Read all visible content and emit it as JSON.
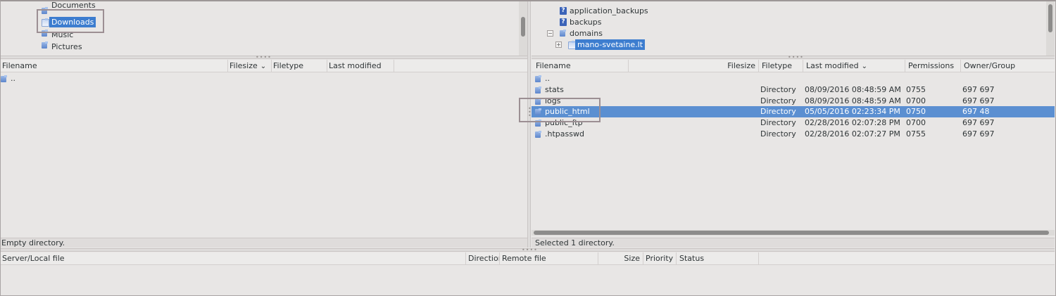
{
  "local_tree": {
    "items": [
      {
        "label": "Documents",
        "selected": false
      },
      {
        "label": "Downloads",
        "selected": true
      },
      {
        "label": "Music",
        "selected": false
      },
      {
        "label": "Pictures",
        "selected": false
      }
    ]
  },
  "remote_tree": {
    "items": [
      {
        "label": "application_backups",
        "icon": "question-icon"
      },
      {
        "label": "backups",
        "icon": "question-icon"
      },
      {
        "label": "domains",
        "icon": "folder-icon",
        "expander": "−"
      },
      {
        "label": "mano-svetaine.lt",
        "icon": "folder-open-icon",
        "expander": "+",
        "selected": true
      }
    ]
  },
  "local_list": {
    "columns": [
      "Filename",
      "Filesize",
      "Filetype",
      "Last modified"
    ],
    "rows": [
      {
        "name": ".."
      }
    ],
    "status": "Empty directory."
  },
  "remote_list": {
    "columns": [
      "Filename",
      "Filesize",
      "Filetype",
      "Last modified",
      "Permissions",
      "Owner/Group"
    ],
    "rows": [
      {
        "name": "..",
        "type": "",
        "modified": "",
        "perm": "",
        "owner": ""
      },
      {
        "name": "stats",
        "type": "Directory",
        "modified": "08/09/2016 08:48:59 AM",
        "perm": "0755",
        "owner": "697 697"
      },
      {
        "name": "logs",
        "type": "Directory",
        "modified": "08/09/2016 08:48:59 AM",
        "perm": "0700",
        "owner": "697 697"
      },
      {
        "name": "public_html",
        "type": "Directory",
        "modified": "05/05/2016 02:23:34 PM",
        "perm": "0750",
        "owner": "697 48",
        "selected": true
      },
      {
        "name": "public_ftp",
        "type": "Directory",
        "modified": "02/28/2016 02:07:28 PM",
        "perm": "0700",
        "owner": "697 697"
      },
      {
        "name": ".htpasswd",
        "type": "Directory",
        "modified": "02/28/2016 02:07:27 PM",
        "perm": "0755",
        "owner": "697 697"
      }
    ],
    "status": "Selected 1 directory."
  },
  "queue": {
    "columns": [
      "Server/Local file",
      "Direction",
      "Remote file",
      "Size",
      "Priority",
      "Status"
    ]
  },
  "colors": {
    "selection": "#5b8fd1",
    "highlight": "#3d7dcf",
    "callout": "#9c8f93"
  }
}
